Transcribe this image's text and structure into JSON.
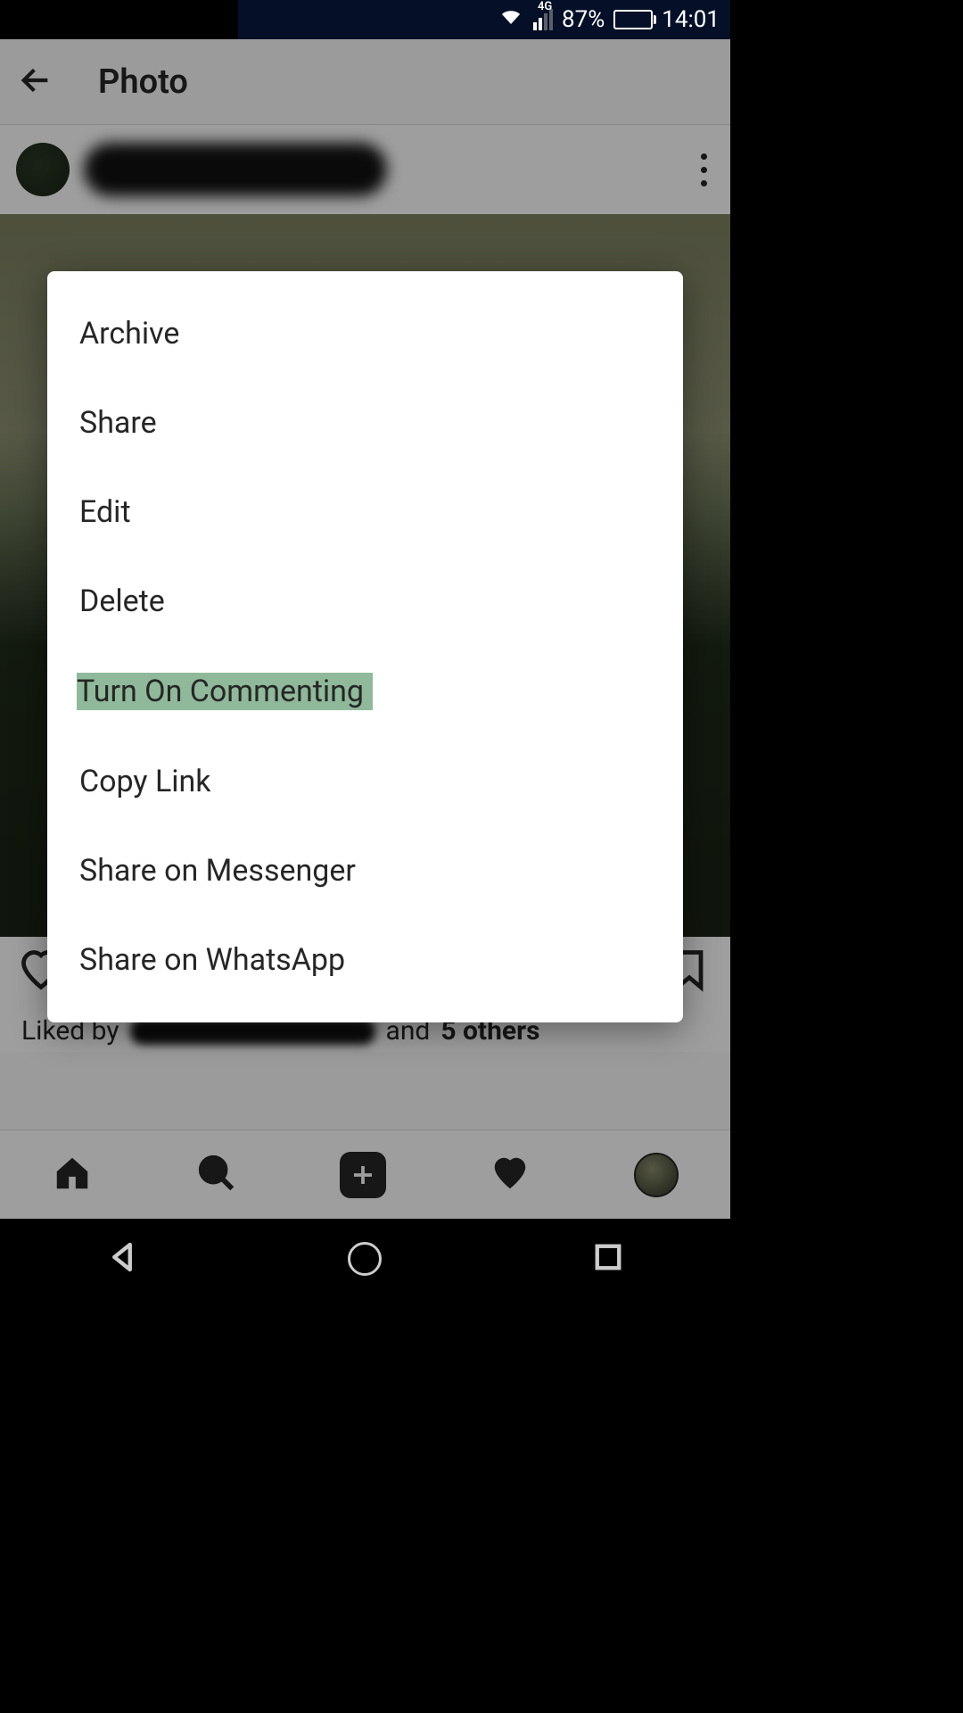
{
  "status": {
    "network": "4G",
    "battery_pct": "87%",
    "time": "14:01"
  },
  "header": {
    "title": "Photo"
  },
  "post": {
    "liked_by_prefix": "Liked by",
    "liked_by_suffix": "and",
    "others": "5 others"
  },
  "modal": {
    "items": [
      {
        "label": "Archive",
        "highlighted": false
      },
      {
        "label": "Share",
        "highlighted": false
      },
      {
        "label": "Edit",
        "highlighted": false
      },
      {
        "label": "Delete",
        "highlighted": false
      },
      {
        "label": "Turn On Commenting",
        "highlighted": true
      },
      {
        "label": "Copy Link",
        "highlighted": false
      },
      {
        "label": "Share on Messenger",
        "highlighted": false
      },
      {
        "label": "Share on WhatsApp",
        "highlighted": false
      }
    ]
  }
}
